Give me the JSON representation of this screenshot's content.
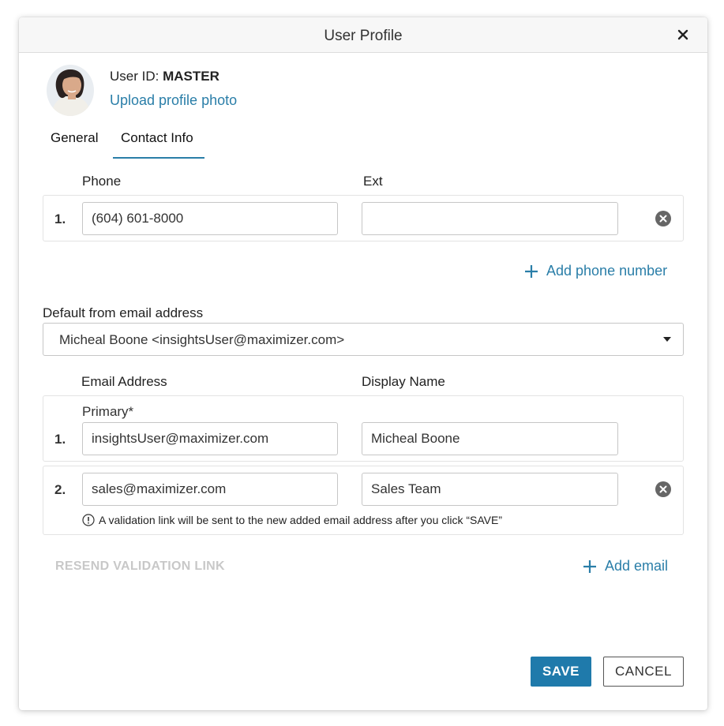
{
  "dialog": {
    "title": "User Profile",
    "close_icon": "close-icon"
  },
  "profile": {
    "user_id_label": "User ID:",
    "user_id_value": "MASTER",
    "upload_label": "Upload profile photo"
  },
  "tabs": [
    {
      "label": "General",
      "active": false
    },
    {
      "label": "Contact Info",
      "active": true
    }
  ],
  "phone": {
    "phone_header": "Phone",
    "ext_header": "Ext",
    "rows": [
      {
        "num": "1.",
        "phone": "(604) 601-8000",
        "ext": ""
      }
    ],
    "add_label": "Add phone number"
  },
  "default_email": {
    "label": "Default from email address",
    "selected": "Micheal Boone <insightsUser@maximizer.com>"
  },
  "email": {
    "address_header": "Email Address",
    "display_header": "Display Name",
    "primary_label": "Primary*",
    "rows": [
      {
        "num": "1.",
        "address": "insightsUser@maximizer.com",
        "display": "Micheal Boone"
      },
      {
        "num": "2.",
        "address": "sales@maximizer.com",
        "display": "Sales Team"
      }
    ],
    "validation_note": "A validation link will be sent to the new added email address after you click “SAVE”",
    "resend_label": "RESEND VALIDATION LINK",
    "add_label": "Add email"
  },
  "actions": {
    "save_label": "SAVE",
    "cancel_label": "CANCEL"
  },
  "colors": {
    "accent": "#2a7ea8",
    "save_button": "#1f7aab",
    "disabled_text": "#c8c8c8"
  }
}
